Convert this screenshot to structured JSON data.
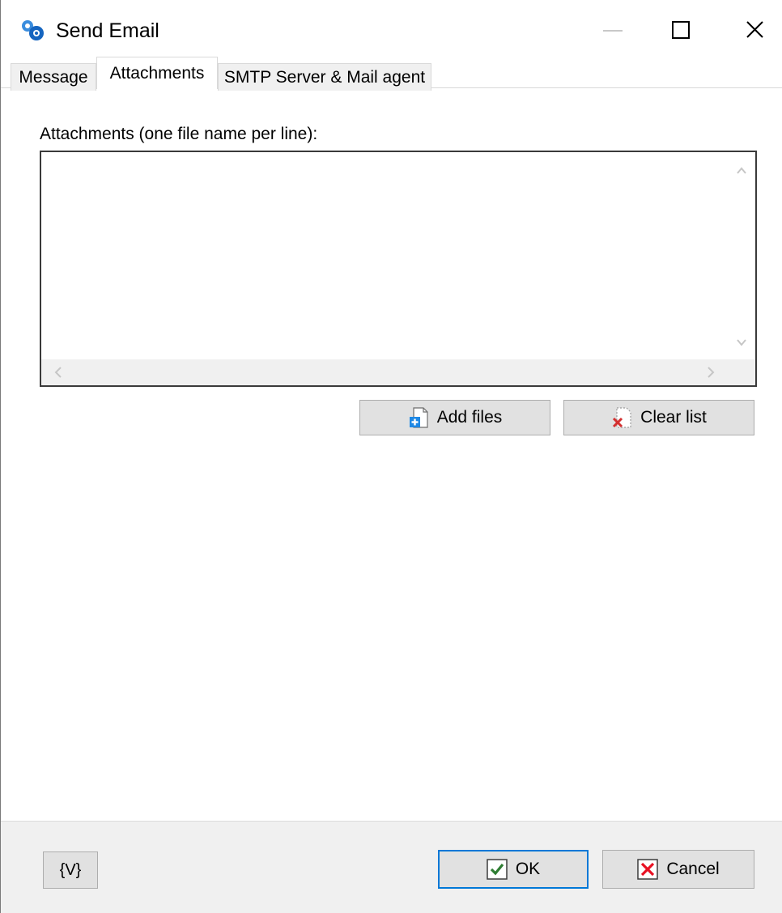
{
  "window": {
    "title": "Send Email",
    "icon": "gears-icon",
    "controls": [
      "minimize-icon",
      "maximize-icon",
      "close-icon"
    ]
  },
  "tabs": [
    {
      "label": "Message",
      "active": false
    },
    {
      "label": "Attachments",
      "active": true
    },
    {
      "label": "SMTP Server & Mail agent",
      "active": false
    }
  ],
  "attachments": {
    "label": "Attachments (one file name per line):",
    "value": "",
    "add_button": {
      "label": "Add files",
      "icon": "add-file-icon"
    },
    "clear_button": {
      "label": "Clear list",
      "icon": "clear-list-icon"
    }
  },
  "footer": {
    "variables_button": "{V}",
    "ok_button": {
      "label": "OK",
      "icon": "checkmark-icon",
      "accent": "#0078d7"
    },
    "cancel_button": {
      "label": "Cancel",
      "icon": "cancel-x-icon",
      "accent": "#e81123"
    }
  }
}
